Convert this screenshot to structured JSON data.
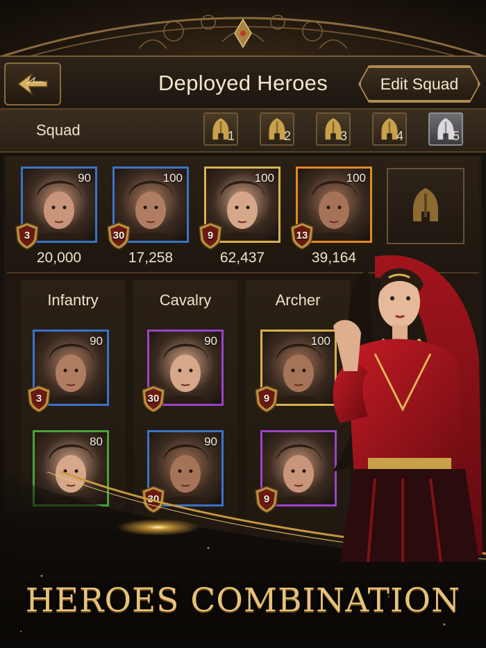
{
  "header": {
    "title": "Deployed Heroes",
    "edit_label": "Edit Squad"
  },
  "squad": {
    "label": "Squad",
    "tabs": [
      {
        "num": "1",
        "active": false
      },
      {
        "num": "2",
        "active": false
      },
      {
        "num": "3",
        "active": false
      },
      {
        "num": "4",
        "active": false
      },
      {
        "num": "5",
        "active": true
      }
    ]
  },
  "deployed": [
    {
      "level": "90",
      "rank": "3",
      "power": "20,000",
      "frame": "blue"
    },
    {
      "level": "100",
      "rank": "30",
      "power": "17,258",
      "frame": "blue"
    },
    {
      "level": "100",
      "rank": "9",
      "power": "62,437",
      "frame": "gold"
    },
    {
      "level": "100",
      "rank": "13",
      "power": "39,164",
      "frame": "orange"
    }
  ],
  "columns": [
    {
      "title": "Infantry",
      "heroes": [
        {
          "level": "90",
          "rank": "3",
          "frame": "blue"
        },
        {
          "level": "80",
          "rank": "",
          "frame": "green"
        }
      ]
    },
    {
      "title": "Cavalry",
      "heroes": [
        {
          "level": "90",
          "rank": "30",
          "frame": "purple"
        },
        {
          "level": "90",
          "rank": "30",
          "frame": "blue"
        }
      ]
    },
    {
      "title": "Archer",
      "heroes": [
        {
          "level": "100",
          "rank": "9",
          "frame": "gold"
        },
        {
          "level": "",
          "rank": "9",
          "frame": "purple"
        }
      ]
    }
  ],
  "banner": {
    "title": "HEROES COMBINATION"
  },
  "colors": {
    "gold": "#d7b34f",
    "blue": "#3b73c8",
    "purple": "#9a45c9",
    "orange": "#e48a24",
    "green": "#47a23c"
  }
}
